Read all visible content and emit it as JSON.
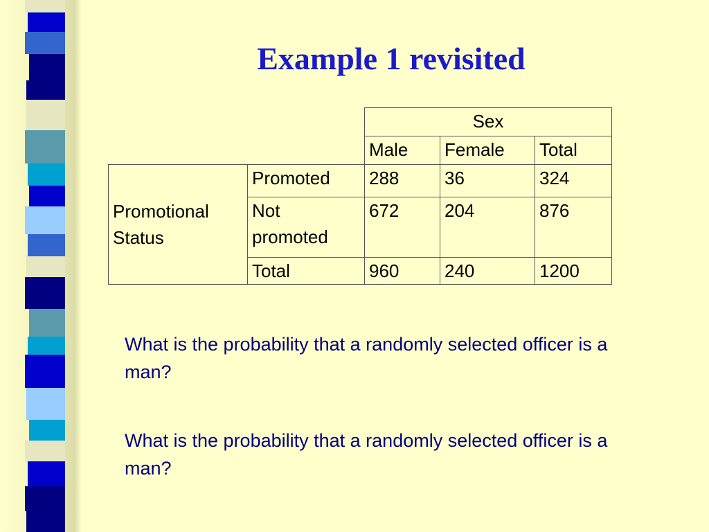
{
  "slide": {
    "title": "Example 1 revisited",
    "questions": [
      "What is the probability that a randomly selected officer is a man?",
      " What is the probability that a randomly selected officer is a man?"
    ]
  },
  "table": {
    "column_group": "Sex",
    "columns": [
      "Male",
      "Female",
      "Total"
    ],
    "row_group": "Promotional Status",
    "rows": [
      {
        "label": "Promoted",
        "values": [
          "288",
          "36",
          "324"
        ]
      },
      {
        "label": "Not promoted",
        "values": [
          "672",
          "204",
          "876"
        ]
      },
      {
        "label": "Total",
        "values": [
          "960",
          "240",
          "1200"
        ]
      }
    ]
  },
  "colors": {
    "background": "#ffffcc",
    "title": "#1a1acc",
    "question_text": "#000080",
    "stripes": [
      "#5aa0cc",
      "#0000cc",
      "#3366cc",
      "#000080",
      "#e6e6c0",
      "#5a9aaa",
      "#00a0d0",
      "#99ccff"
    ]
  }
}
